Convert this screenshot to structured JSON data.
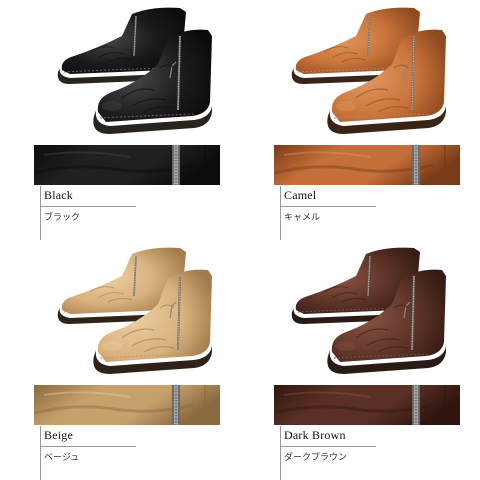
{
  "products": [
    {
      "name": "Black",
      "name_ja": "ブラック",
      "colors": {
        "upper": "#1c1c1e",
        "shade": "#0b0b0c",
        "highlight": "#4a4a4d",
        "sole": "#2a2420",
        "welt": "#7a6550",
        "swatch": "#202022",
        "swatch_dark": "#0c0c0d"
      }
    },
    {
      "name": "Camel",
      "name_ja": "キャメル",
      "colors": {
        "upper": "#c9733a",
        "shade": "#8f4a20",
        "highlight": "#e29a62",
        "sole": "#3a2418",
        "welt": "#b8865a",
        "swatch": "#c5703a",
        "swatch_dark": "#7a3c18"
      }
    },
    {
      "name": "Beige",
      "name_ja": "ベージュ",
      "colors": {
        "upper": "#d9b27e",
        "shade": "#a27c4c",
        "highlight": "#ecd0a4",
        "sole": "#2f2218",
        "welt": "#c29a66",
        "swatch": "#c8a06c",
        "swatch_dark": "#8a6a40"
      }
    },
    {
      "name": "Dark Brown",
      "name_ja": "ダークブラウン",
      "colors": {
        "upper": "#5e3428",
        "shade": "#361c14",
        "highlight": "#8a5444",
        "sole": "#2a1a14",
        "welt": "#7a5240",
        "swatch": "#5a3024",
        "swatch_dark": "#301610"
      }
    }
  ]
}
